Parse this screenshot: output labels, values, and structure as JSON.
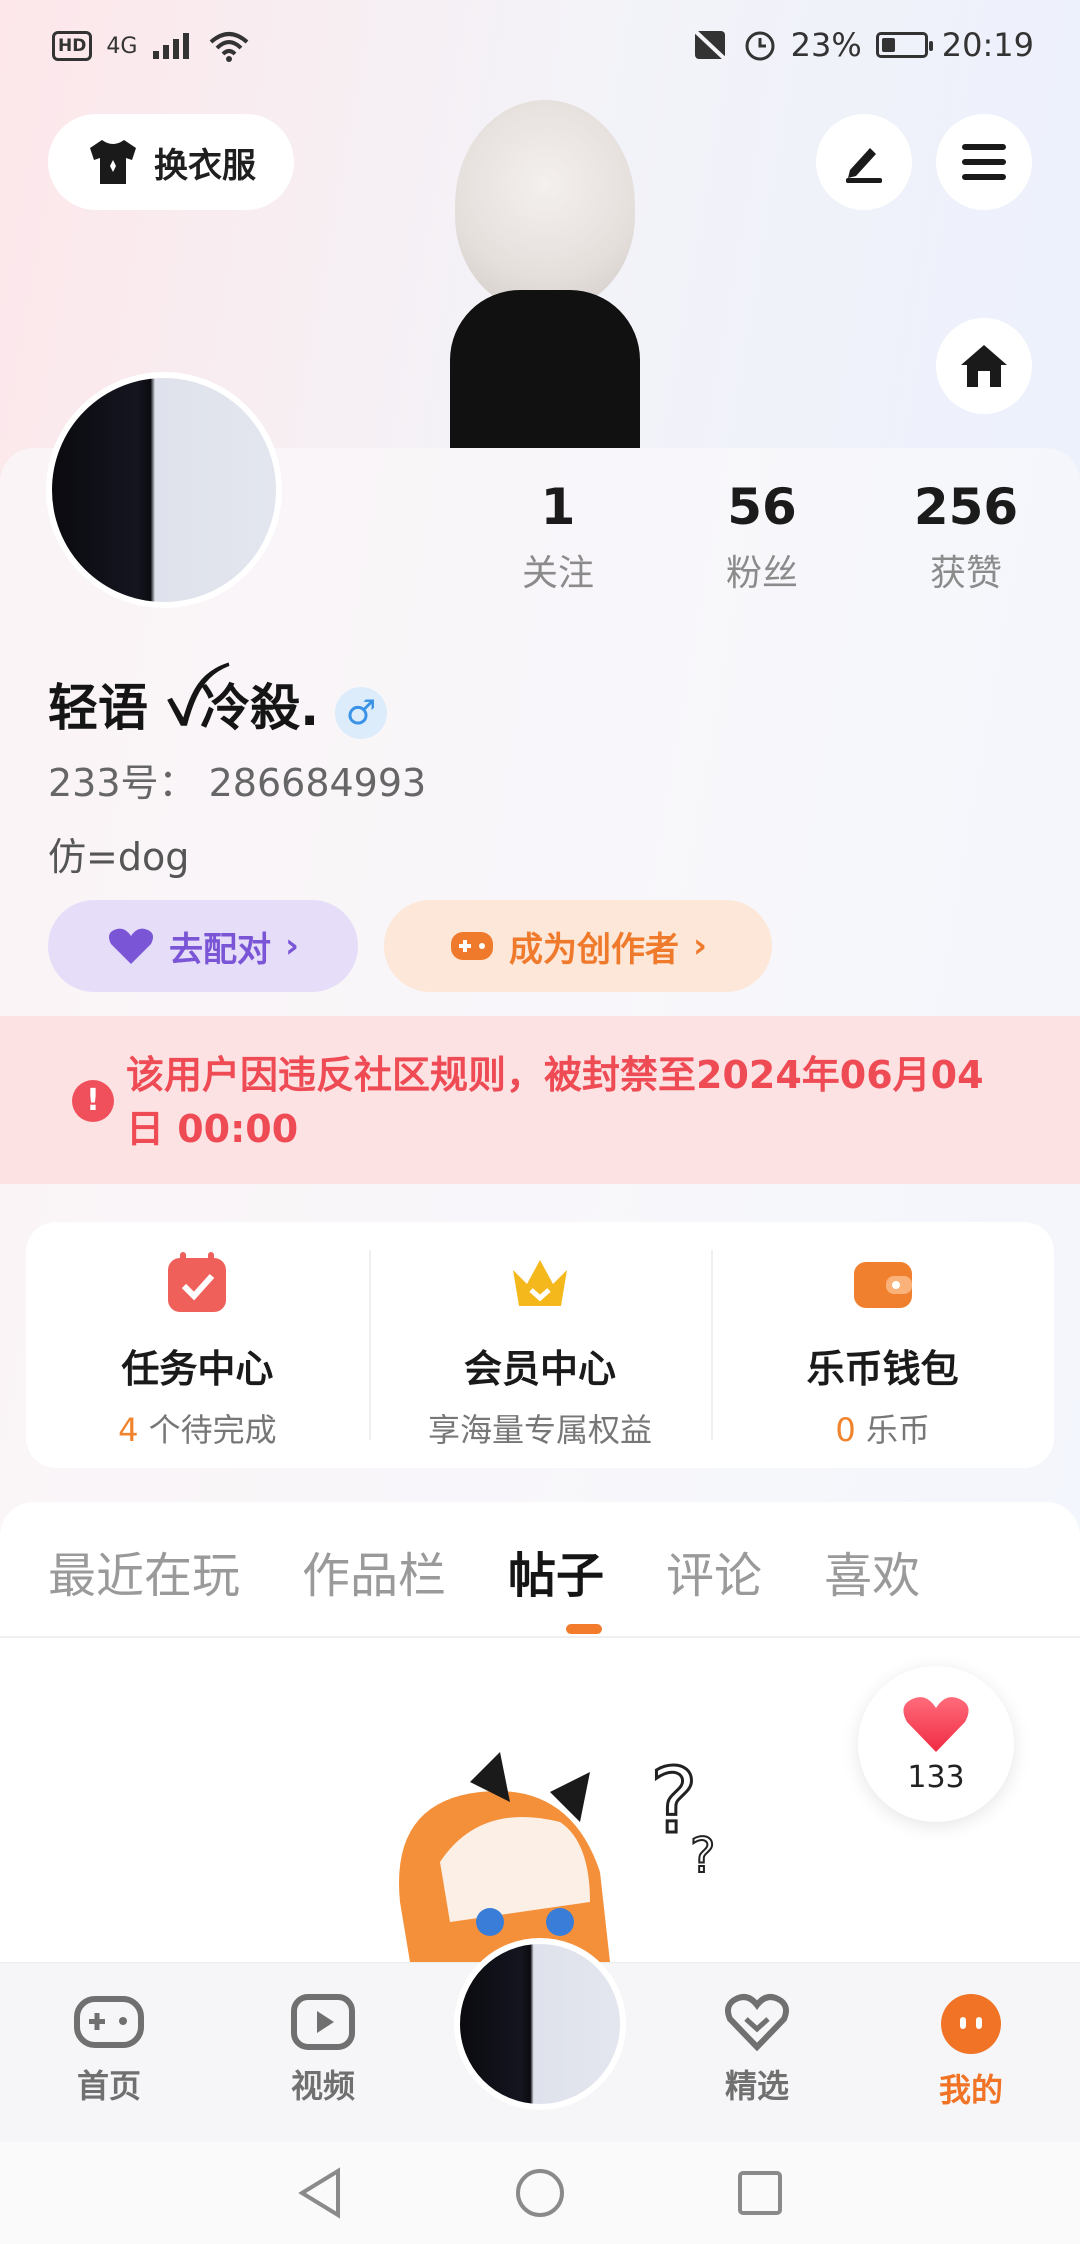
{
  "status_bar": {
    "hd": "HD",
    "network": "4G",
    "battery_pct": "23%",
    "time": "20:19",
    "battery_level": 0.23
  },
  "header": {
    "dress_label": "换衣服",
    "edit_icon": "pen-icon",
    "menu_icon": "menu-icon",
    "home_icon": "home-icon"
  },
  "profile": {
    "stats": [
      {
        "value": "1",
        "label": "关注"
      },
      {
        "value": "56",
        "label": "粉丝"
      },
      {
        "value": "256",
        "label": "获赞"
      }
    ],
    "nickname": "轻语 ꪜ冷殺.",
    "gender_symbol": "♂",
    "uid_text": "233号： 286684993",
    "bio": "仿=dog"
  },
  "actions": {
    "match_label": "去配对",
    "creator_label": "成为创作者"
  },
  "ban_notice": {
    "text": "该用户因违反社区规则，被封禁至2024年06月04日 00:00"
  },
  "services": [
    {
      "title": "任务中心",
      "count": "4",
      "sub": " 个待完成",
      "icon_color": "#f0605a"
    },
    {
      "title": "会员中心",
      "count": "",
      "sub": "享海量专属权益",
      "icon_color": "#f5b81c"
    },
    {
      "title": "乐币钱包",
      "count": "0",
      "sub": " 乐币",
      "icon_color": "#f07f2e"
    }
  ],
  "tabs": [
    {
      "label": "最近在玩",
      "active": false
    },
    {
      "label": "作品栏",
      "active": false
    },
    {
      "label": "帖子",
      "active": true
    },
    {
      "label": "评论",
      "active": false
    },
    {
      "label": "喜欢",
      "active": false
    }
  ],
  "like_bubble": {
    "count": "133"
  },
  "bottom_nav": [
    {
      "label": "首页",
      "icon": "gamepad-icon",
      "active": false
    },
    {
      "label": "视频",
      "icon": "video-play-icon",
      "active": false
    },
    {
      "label": "精选",
      "icon": "heart-badge-icon",
      "active": false
    },
    {
      "label": "我的",
      "icon": "face-icon",
      "active": true
    }
  ],
  "accent_color": "#f07326",
  "ban_color": "#ee4b55"
}
